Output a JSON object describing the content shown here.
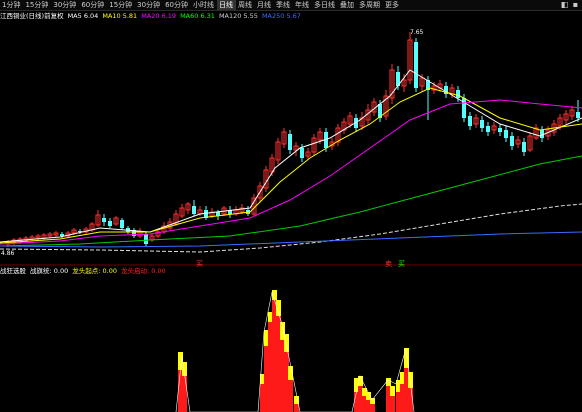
{
  "toolbar": {
    "items": [
      {
        "label": "1分钟",
        "active": false
      },
      {
        "label": "15分钟",
        "active": false
      },
      {
        "label": "30分钟",
        "active": false
      },
      {
        "label": "60分钟",
        "active": false
      },
      {
        "label": "15分钟",
        "active": false
      },
      {
        "label": "30分钟",
        "active": false
      },
      {
        "label": "60分钟",
        "active": false
      },
      {
        "label": "小时线",
        "active": false
      },
      {
        "label": "日线",
        "active": true
      },
      {
        "label": "周线",
        "active": false
      },
      {
        "label": "月线",
        "active": false
      },
      {
        "label": "季线",
        "active": false
      },
      {
        "label": "年线",
        "active": false
      },
      {
        "label": "多日线",
        "active": false
      },
      {
        "label": "叠加",
        "active": false
      },
      {
        "label": "多周期",
        "active": false
      },
      {
        "label": "更多",
        "active": false
      }
    ]
  },
  "main_legend": {
    "name": "江西铜业(日线)前复权",
    "items": [
      {
        "text": "MA5 6.04",
        "color": "#ffffff"
      },
      {
        "text": "MA10 5.81",
        "color": "#ffff00"
      },
      {
        "text": "MA20 6.19",
        "color": "#ff00ff"
      },
      {
        "text": "MA60 6.31",
        "color": "#00ff00"
      },
      {
        "text": "MA120 5.55",
        "color": "#cccccc"
      },
      {
        "text": "MA250 5.67",
        "color": "#3a6bff"
      }
    ]
  },
  "sub_legend": {
    "name": "战狂选股",
    "items": [
      {
        "text": "战旗统: 0.00",
        "color": "#ffffff"
      },
      {
        "text": "龙头起点: 0.00",
        "color": "#ffff00"
      },
      {
        "text": "龙头启动: 0.00",
        "color": "#ff2020"
      }
    ]
  },
  "annotations": {
    "high_value": "7.65",
    "low_value": "4.86",
    "buy_label": "买",
    "sell_label": "卖"
  },
  "colors": {
    "up": "#ff3030",
    "down": "#54ffff",
    "ma5": "#ffffff",
    "ma10": "#ffff00",
    "ma20": "#ff00ff",
    "ma60": "#00cc00",
    "ma120": "#e0e0e0",
    "ma250": "#3a6bff"
  }
}
